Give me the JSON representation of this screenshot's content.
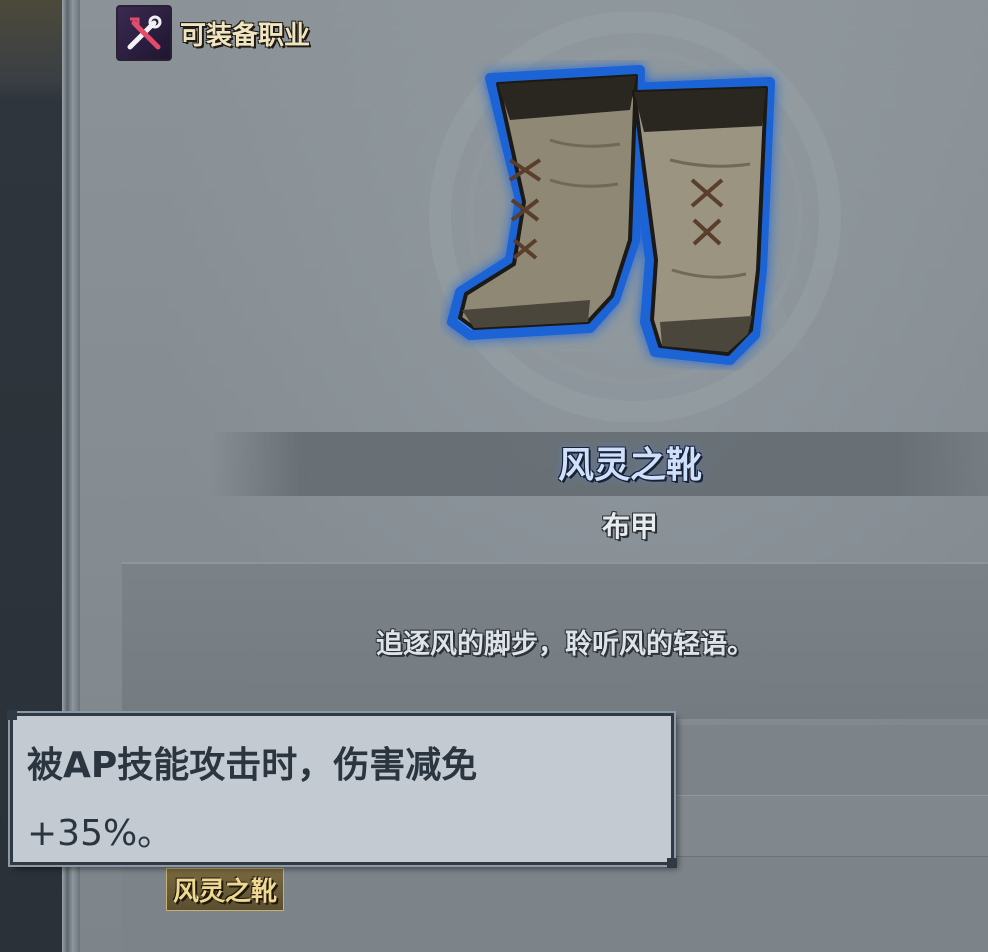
{
  "header": {
    "class_label": "可装备职业",
    "class_icon": "crossed-tools-icon"
  },
  "item": {
    "name": "风灵之靴",
    "type": "布甲",
    "description": "追逐风的脚步，聆听风的轻语。",
    "icon": "boots-icon",
    "glow_color": "#2f8fff"
  },
  "stats": {
    "partial_value": "0"
  },
  "set": {
    "name": "风灵之靴"
  },
  "tooltip": {
    "line1": "被AP技能攻击时，伤害减免",
    "line2": "+35%。"
  }
}
